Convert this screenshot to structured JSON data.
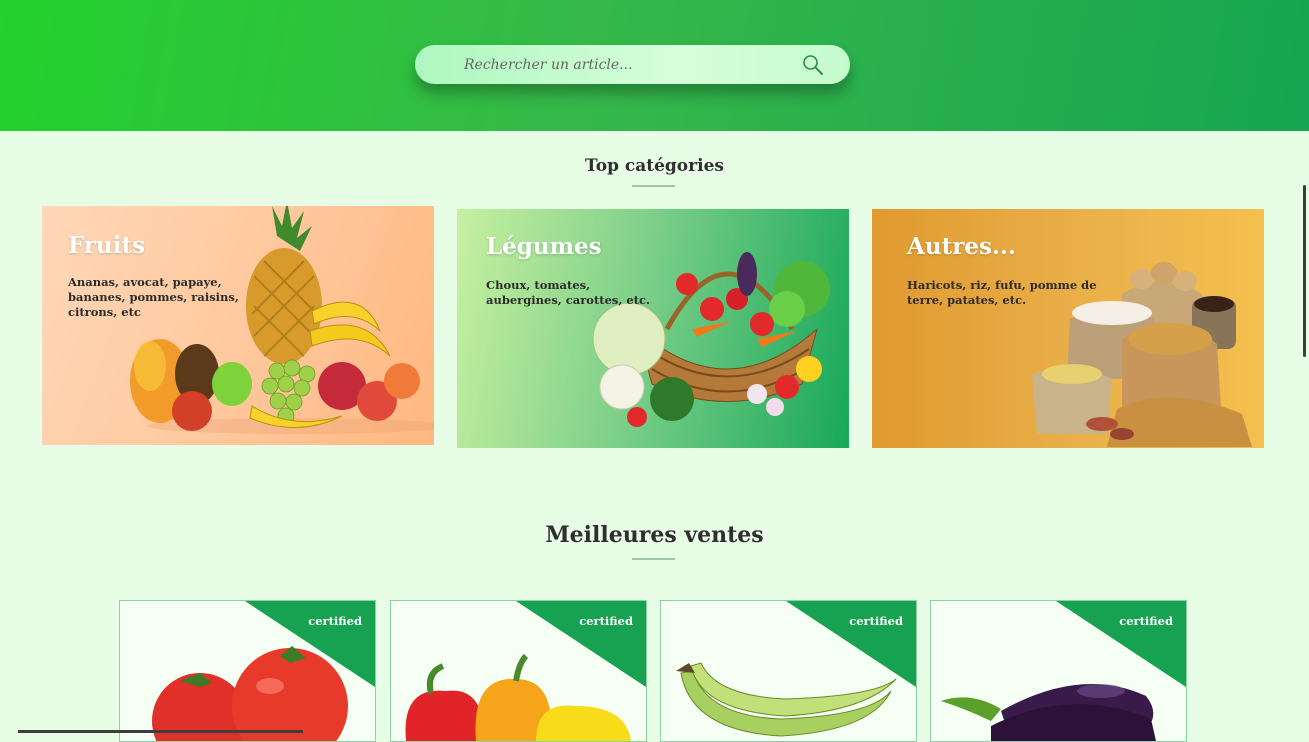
{
  "search": {
    "placeholder": "Rechercher un article..."
  },
  "top_categories": {
    "title": "Top catégories",
    "items": [
      {
        "title": "Fruits",
        "description": "Ananas, avocat, papaye, bananes, pommes, raisins, citrons, etc"
      },
      {
        "title": "Légumes",
        "description": "Choux, tomates, aubergines, carottes, etc."
      },
      {
        "title": "Autres...",
        "description": "Haricots, riz, fufu, pomme de terre, patates, etc."
      }
    ]
  },
  "best_sellers": {
    "title": "Meilleures ventes",
    "products": [
      {
        "badge": "certified",
        "image": "tomatoes"
      },
      {
        "badge": "certified",
        "image": "bell-peppers"
      },
      {
        "badge": "certified",
        "image": "plantains"
      },
      {
        "badge": "certified",
        "image": "eggplants"
      }
    ]
  },
  "colors": {
    "header_green": "#22d12c",
    "accent_green": "#16a550",
    "page_bg": "#e8fde6"
  }
}
